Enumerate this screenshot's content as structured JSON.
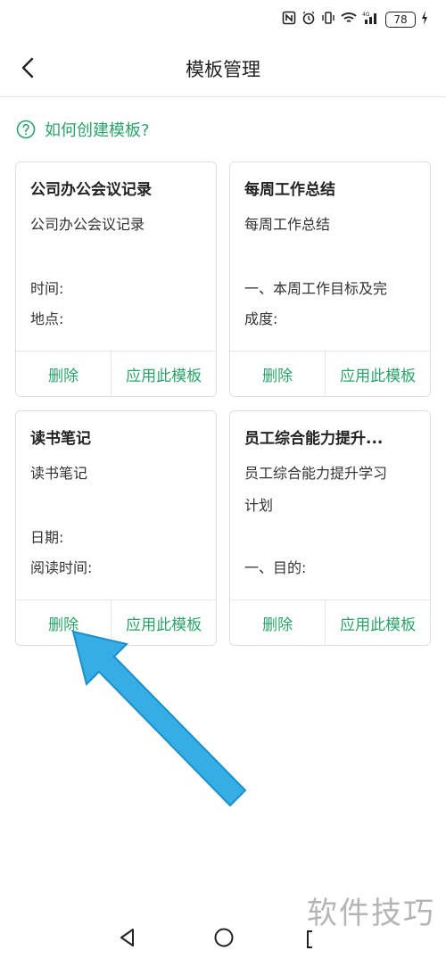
{
  "status": {
    "battery": "78"
  },
  "header": {
    "title": "模板管理"
  },
  "help": {
    "text": "如何创建模板?"
  },
  "cards": [
    {
      "title": "公司办公会议记录",
      "lines": [
        "公司办公会议记录",
        "",
        "时间:",
        "地点:"
      ],
      "delete": "删除",
      "apply": "应用此模板"
    },
    {
      "title": "每周工作总结",
      "lines": [
        "每周工作总结",
        "",
        "一、本周工作目标及完",
        "成度:"
      ],
      "delete": "删除",
      "apply": "应用此模板"
    },
    {
      "title": "读书笔记",
      "lines": [
        "读书笔记",
        "",
        "日期:",
        "阅读时间:"
      ],
      "delete": "删除",
      "apply": "应用此模板"
    },
    {
      "title": "员工综合能力提升...",
      "lines": [
        "员工综合能力提升学习",
        "计划",
        "",
        "一、目的:"
      ],
      "delete": "删除",
      "apply": "应用此模板"
    }
  ],
  "watermark": "软件技巧",
  "colors": {
    "accent": "#2aa36b",
    "arrow": "#35aee6"
  }
}
